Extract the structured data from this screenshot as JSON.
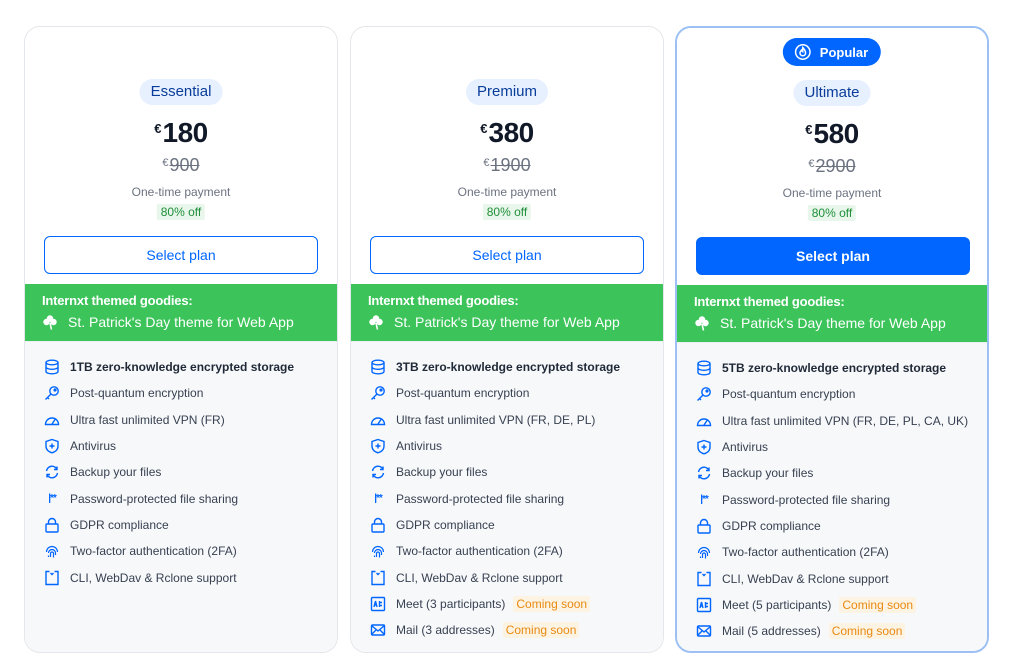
{
  "colors": {
    "accent": "#0066ff",
    "goodies_bg": "#3cc45a",
    "discount_text": "#1f8f3a",
    "coming_soon_text": "#e88a12"
  },
  "plans": [
    {
      "name": "Essential",
      "currency": "€",
      "price": "180",
      "old_price": "900",
      "payment": "One-time payment",
      "discount": "80% off",
      "button": "Select plan",
      "goodies_title": "Internxt themed goodies:",
      "goodies_item": "St. Patrick's Day theme for Web App",
      "features": [
        "1TB zero-knowledge encrypted storage",
        "Post-quantum encryption",
        "Ultra fast unlimited VPN (FR)",
        "Antivirus",
        "Backup your files",
        "Password-protected file sharing",
        "GDPR compliance",
        "Two-factor authentication (2FA)",
        "CLI, WebDav & Rclone support"
      ]
    },
    {
      "name": "Premium",
      "currency": "€",
      "price": "380",
      "old_price": "1900",
      "payment": "One-time payment",
      "discount": "80% off",
      "button": "Select plan",
      "goodies_title": "Internxt themed goodies:",
      "goodies_item": "St. Patrick's Day theme for Web App",
      "features": [
        "3TB zero-knowledge encrypted storage",
        "Post-quantum encryption",
        "Ultra fast unlimited VPN (FR, DE, PL)",
        "Antivirus",
        "Backup your files",
        "Password-protected file sharing",
        "GDPR compliance",
        "Two-factor authentication (2FA)",
        "CLI, WebDav & Rclone support",
        "Meet (3 participants)",
        "Mail (3 addresses)"
      ],
      "coming_soon": "Coming soon"
    },
    {
      "name": "Ultimate",
      "badge": "Popular",
      "currency": "€",
      "price": "580",
      "old_price": "2900",
      "payment": "One-time payment",
      "discount": "80% off",
      "button": "Select plan",
      "goodies_title": "Internxt themed goodies:",
      "goodies_item": "St. Patrick's Day theme for Web App",
      "features": [
        "5TB zero-knowledge encrypted storage",
        "Post-quantum encryption",
        "Ultra fast unlimited VPN (FR, DE, PL, CA, UK)",
        "Antivirus",
        "Backup your files",
        "Password-protected file sharing",
        "GDPR compliance",
        "Two-factor authentication (2FA)",
        "CLI, WebDav & Rclone support",
        "Meet (5 participants)",
        "Mail (5 addresses)"
      ],
      "coming_soon": "Coming soon"
    }
  ]
}
